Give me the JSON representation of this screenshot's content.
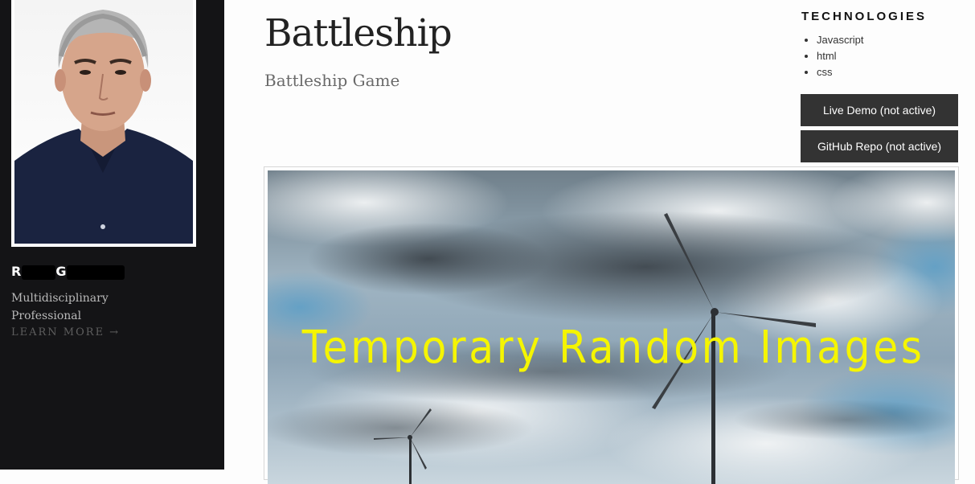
{
  "sidebar": {
    "name_visible_start": "R",
    "name_visible_mid": "G",
    "role": "Multidisciplinary Professional",
    "learn_more": "LEARN MORE →"
  },
  "project": {
    "title": "Battleship",
    "subtitle": "Battleship Game",
    "technologies_heading": "TECHNOLOGIES",
    "technologies": [
      "Javascript",
      "html",
      "css"
    ],
    "live_demo_label": "Live Demo (not active)",
    "repo_label": "GitHub Repo (not active)",
    "image_caption": "Temporary Random Images"
  },
  "colors": {
    "sidebar_bg": "#141416",
    "button_bg": "#333333",
    "caption_color": "#f5f500"
  },
  "icons": {
    "learn_more_arrow": "right-arrow-icon"
  }
}
